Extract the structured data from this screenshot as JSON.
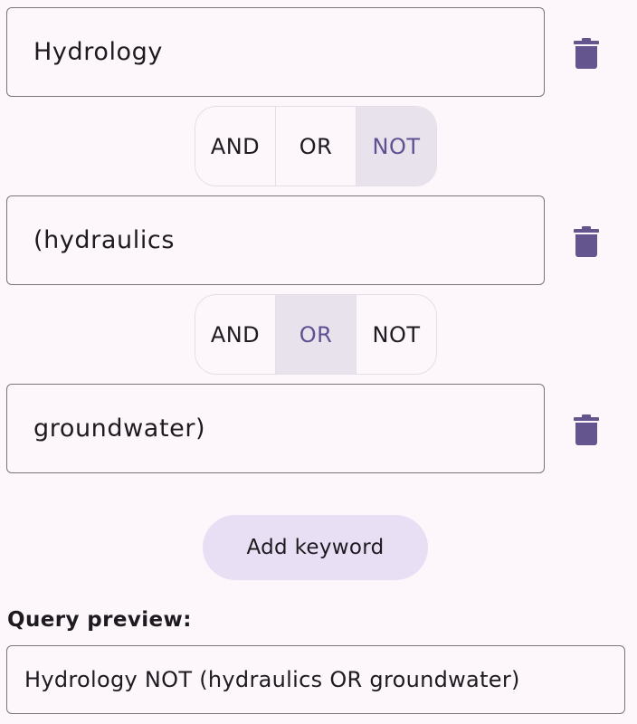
{
  "keywords": [
    {
      "value": "Hydrology",
      "delete_icon": "trash-icon"
    },
    {
      "value": "(hydraulics",
      "delete_icon": "trash-icon"
    },
    {
      "value": "groundwater)",
      "delete_icon": "trash-icon"
    }
  ],
  "operators": [
    {
      "options": [
        "AND",
        "OR",
        "NOT"
      ],
      "selected": "NOT"
    },
    {
      "options": [
        "AND",
        "OR",
        "NOT"
      ],
      "selected": "OR"
    }
  ],
  "add_button_label": "Add keyword",
  "preview": {
    "label": "Query preview:",
    "text": "Hydrology NOT (hydraulics OR groundwater)"
  },
  "colors": {
    "background": "#fdf7fc",
    "accent": "#5e5192",
    "icon": "#65558f",
    "selected_segment": "#e8e2ec",
    "tonal_button": "#e8dff5",
    "outline": "#79747e"
  }
}
